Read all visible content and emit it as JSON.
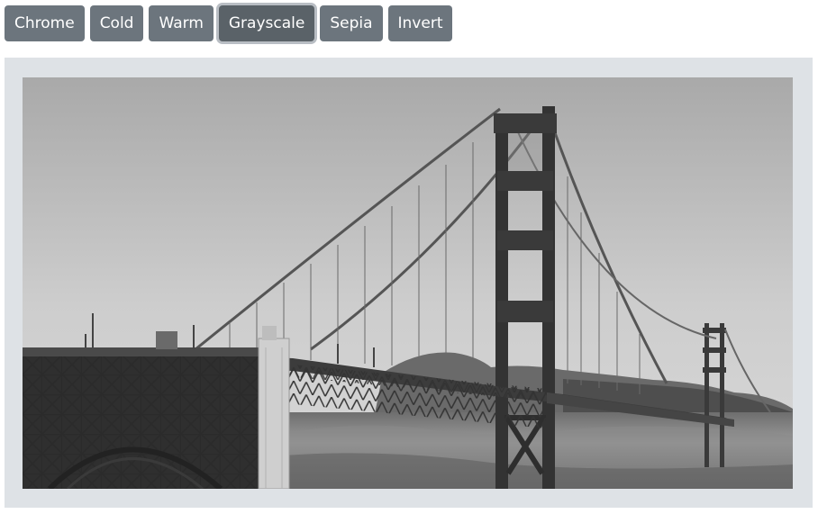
{
  "toolbar": {
    "buttons": [
      {
        "id": "chrome",
        "label": "Chrome"
      },
      {
        "id": "cold",
        "label": "Cold"
      },
      {
        "id": "warm",
        "label": "Warm"
      },
      {
        "id": "grayscale",
        "label": "Grayscale"
      },
      {
        "id": "sepia",
        "label": "Sepia"
      },
      {
        "id": "invert",
        "label": "Invert"
      }
    ],
    "active": "grayscale"
  },
  "photo": {
    "subject": "golden-gate-bridge-photo",
    "filter": "grayscale"
  },
  "colors": {
    "button_bg": "#6c757d",
    "button_active_bg": "#5a6268",
    "button_text": "#ffffff",
    "frame_bg": "#dee2e6"
  }
}
